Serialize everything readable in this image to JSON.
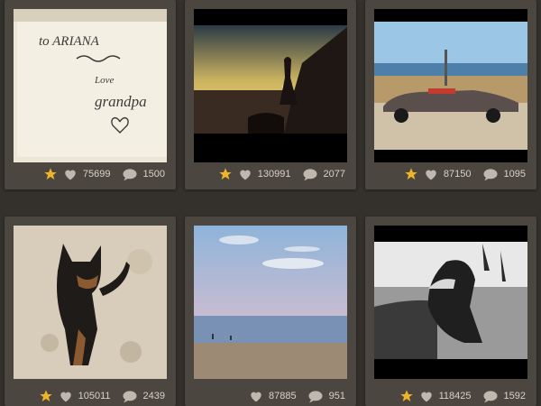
{
  "cards": [
    {
      "likes": "75699",
      "comments": "1500",
      "starred": true
    },
    {
      "likes": "130991",
      "comments": "2077",
      "starred": true
    },
    {
      "likes": "87150",
      "comments": "1095",
      "starred": true
    },
    {
      "likes": "105011",
      "comments": "2439",
      "starred": true
    },
    {
      "likes": "87885",
      "comments": "951",
      "starred": false
    },
    {
      "likes": "118425",
      "comments": "1592",
      "starred": true
    }
  ],
  "handwritten_note": {
    "line1": "to ARIANA",
    "line2": "Love",
    "line3": "grandpa"
  },
  "colors": {
    "background": "#34302c",
    "card": "#4b4640",
    "star": "#f0b429",
    "icon": "#bfb8ae"
  }
}
